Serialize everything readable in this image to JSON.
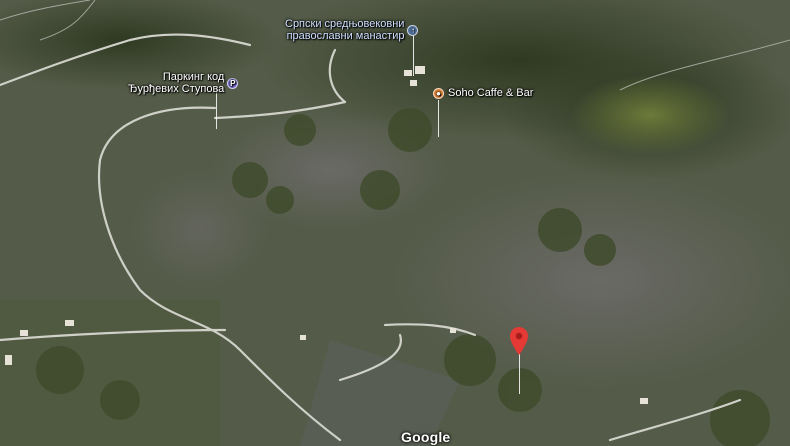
{
  "map": {
    "view": "satellite",
    "pois": {
      "parking": {
        "line1": "Паркинг код",
        "line2": "Ђурђевих Ступова",
        "icon": "parking-icon",
        "color": "#7b6ed6"
      },
      "monastery": {
        "line1": "Српски средњовековни",
        "line2": "православни манастир",
        "icon": "monastery-icon",
        "color": "#4f6f9a"
      },
      "cafe": {
        "label": "Soho Caffe & Bar",
        "icon": "cafe-icon",
        "color": "#e8883a"
      }
    },
    "marker": {
      "icon": "red-location-pin-icon",
      "color": "#e53935"
    },
    "logo": "Google"
  }
}
